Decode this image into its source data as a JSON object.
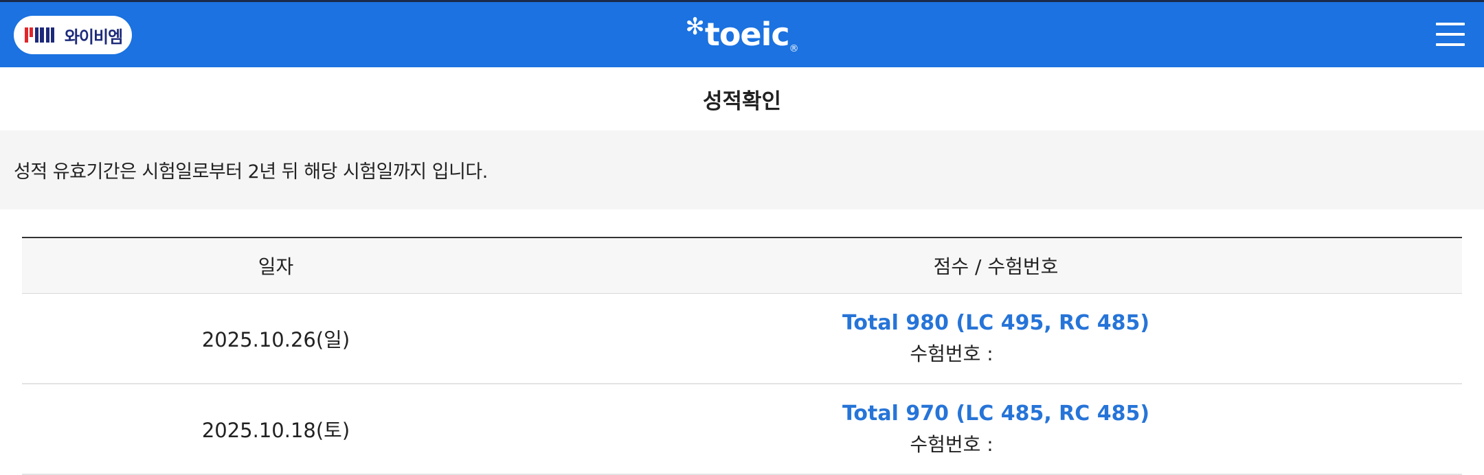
{
  "header": {
    "ybm_label": "와이비엠",
    "brand_star": "✻",
    "brand_text": "toeic",
    "brand_dot": "®"
  },
  "page": {
    "title": "성적확인",
    "notice": "성적 유효기간은 시험일로부터 2년 뒤 해당 시험일까지 입니다."
  },
  "table": {
    "headers": [
      "일자",
      "점수 / 수험번호"
    ],
    "rows": [
      {
        "date": "2025.10.26(일)",
        "score": "Total 980 (LC 495, RC 485)",
        "exam_label": "수험번호 :",
        "exam_number": ""
      },
      {
        "date": "2025.10.18(토)",
        "score": "Total 970 (LC 485, RC 485)",
        "exam_label": "수험번호 :",
        "exam_number": ""
      }
    ]
  },
  "colors": {
    "header_blue": "#1b72e0",
    "score_blue": "#2674d8",
    "ybm_red": "#e0262b",
    "ybm_navy": "#1d2a7a"
  },
  "icons": {
    "ybm_logo": "ybm-logo-icon",
    "menu": "hamburger-menu-icon"
  }
}
